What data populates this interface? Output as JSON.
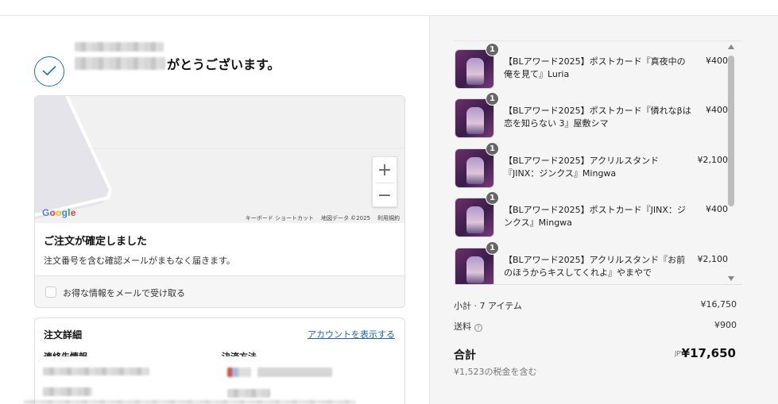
{
  "header": {
    "thanks_text": "がとうございます。"
  },
  "map": {
    "logo": "Google",
    "zoom_in": "+",
    "zoom_out": "−",
    "credits": [
      "キーボード ショートカット",
      "地図データ ©2025",
      "利用規約"
    ]
  },
  "confirmation": {
    "title": "ご注文が確定しました",
    "subtitle": "注文番号を含む確認メールがまもなく届きます。",
    "newsletter_label": "お得な情報をメールで受け取る"
  },
  "details": {
    "title": "注文詳細",
    "account_link": "アカウントを表示する",
    "contact_label": "連絡先情報",
    "payment_label": "決済方法"
  },
  "summary": {
    "items": [
      {
        "qty": "1",
        "name": "【BLアワード2025】ポストカード『真夜中の俺を見て』Luria",
        "price": "¥400"
      },
      {
        "qty": "1",
        "name": "【BLアワード2025】ポストカード『憐れなβは恋を知らない 3』屋敷シマ",
        "price": "¥400"
      },
      {
        "qty": "1",
        "name": "【BLアワード2025】アクリルスタンド『JINX：ジンクス』Mingwa",
        "price": "¥2,100"
      },
      {
        "qty": "1",
        "name": "【BLアワード2025】ポストカード『JINX：ジンクス』Mingwa",
        "price": "¥400"
      },
      {
        "qty": "1",
        "name": "【BLアワード2025】アクリルスタンド『お前のほうからキスしてくれよ』やまやで",
        "price": "¥2,100"
      }
    ],
    "subtotal_label": "小計 · 7 アイテム",
    "subtotal_value": "¥16,750",
    "shipping_label": "送料",
    "shipping_value": "¥900",
    "total_label": "合計",
    "total_currency": "JPY",
    "total_value": "¥17,650",
    "tax_note": "¥1,523の税金を含む"
  }
}
